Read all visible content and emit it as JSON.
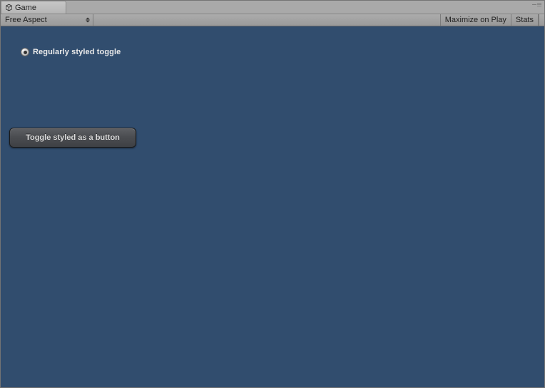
{
  "tab": {
    "title": "Game"
  },
  "toolbar": {
    "aspect": "Free Aspect",
    "maximize": "Maximize on Play",
    "stats": "Stats"
  },
  "content": {
    "regular_toggle_label": "Regularly styled toggle",
    "button_toggle_label": "Toggle styled as a button"
  },
  "colors": {
    "game_bg": "#314d6e"
  }
}
